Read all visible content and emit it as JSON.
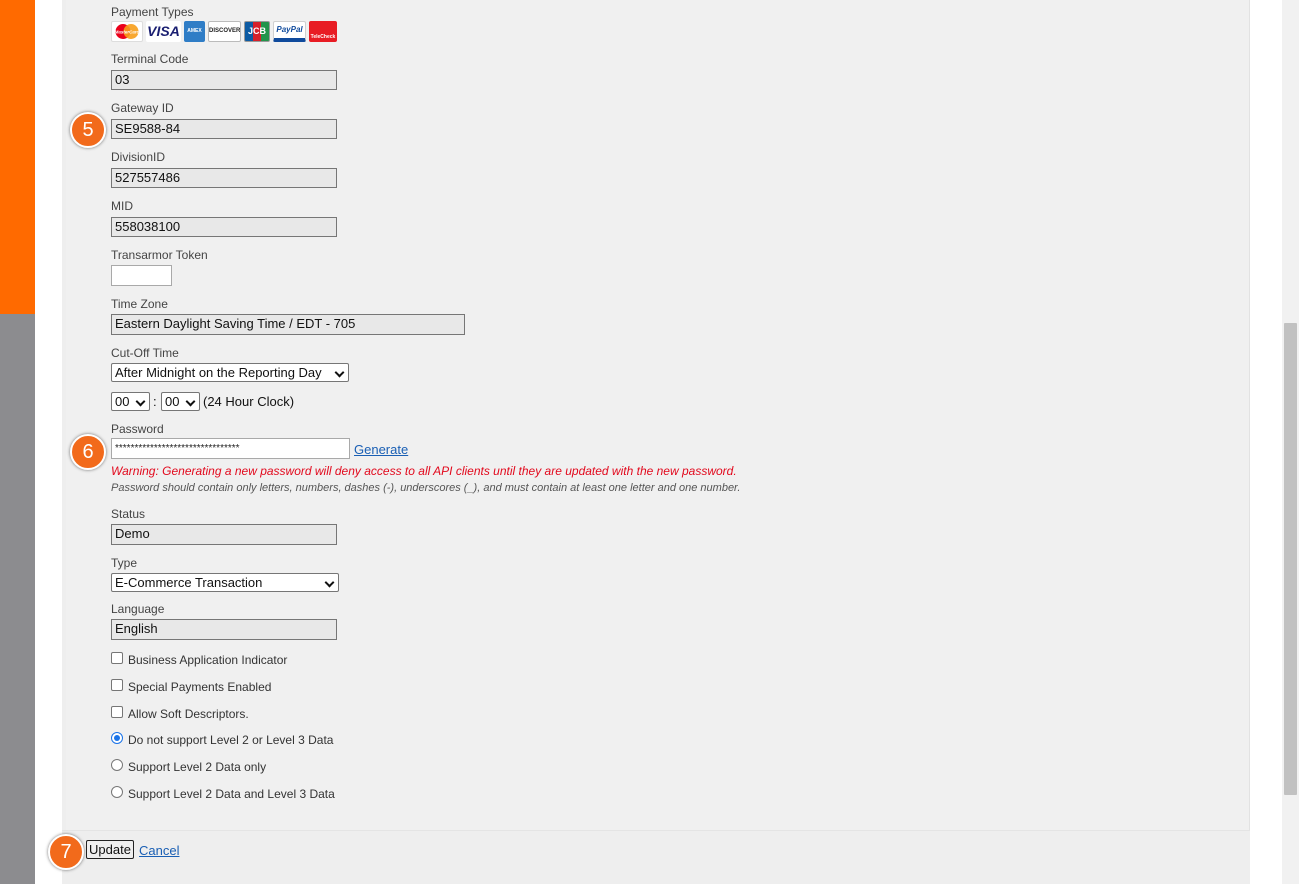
{
  "payment_types": {
    "label": "Payment Types",
    "cards": [
      {
        "name": "mastercard-icon",
        "text": "MasterCard"
      },
      {
        "name": "visa-icon",
        "text": "VISA"
      },
      {
        "name": "amex-icon",
        "text": "AMEX"
      },
      {
        "name": "discover-icon",
        "text": "DISCOVER"
      },
      {
        "name": "jcb-icon",
        "text": "JCB"
      },
      {
        "name": "paypal-icon",
        "text": "PayPal"
      },
      {
        "name": "telecheck-icon",
        "text": "TeleCheck"
      }
    ]
  },
  "fields": {
    "terminal_code": {
      "label": "Terminal Code",
      "value": "03"
    },
    "gateway_id": {
      "label": "Gateway ID",
      "value": "SE9588-84"
    },
    "division_id": {
      "label": "DivisionID",
      "value": "527557486"
    },
    "mid": {
      "label": "MID",
      "value": "558038100"
    },
    "transarmor_token": {
      "label": "Transarmor Token",
      "value": ""
    },
    "time_zone": {
      "label": "Time Zone",
      "value": "Eastern Daylight Saving Time / EDT - 705"
    },
    "cutoff_time": {
      "label": "Cut-Off Time",
      "value": "After Midnight on the Reporting Day",
      "hour": "00",
      "minute": "00",
      "separator": ":",
      "clock_note": "(24 Hour Clock)"
    },
    "password": {
      "label": "Password",
      "value": "********************************",
      "generate": "Generate",
      "warning": "Warning: Generating a new password will deny access to all API clients until they are updated with the new password.",
      "hint": "Password should contain only letters, numbers, dashes (-), underscores (_), and must contain at least one letter and one number."
    },
    "status": {
      "label": "Status",
      "value": "Demo"
    },
    "type": {
      "label": "Type",
      "value": "E-Commerce Transaction"
    },
    "language": {
      "label": "Language",
      "value": "English"
    }
  },
  "checkboxes": [
    {
      "label": "Business Application Indicator",
      "checked": false
    },
    {
      "label": "Special Payments Enabled",
      "checked": false
    },
    {
      "label": "Allow Soft Descriptors.",
      "checked": false
    }
  ],
  "level_data_options": [
    {
      "label": "Do not support Level 2 or Level 3 Data",
      "selected": true
    },
    {
      "label": "Support Level 2 Data only",
      "selected": false
    },
    {
      "label": "Support Level 2 Data and Level 3 Data",
      "selected": false
    }
  ],
  "actions": {
    "update": "Update",
    "cancel": "Cancel"
  },
  "step_badges": {
    "gateway": "5",
    "password": "6",
    "update": "7"
  },
  "colors": {
    "accent": "#ff6a00",
    "badge": "#f26a1b",
    "warning": "#e2091d",
    "link": "#1a5fb4"
  }
}
